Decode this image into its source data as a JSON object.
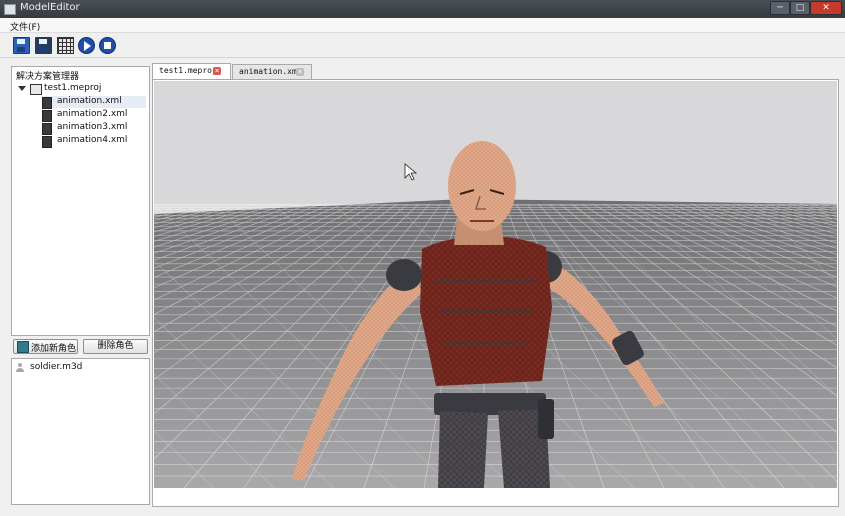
{
  "window": {
    "title": "ModelEditor",
    "controls": {
      "min": "─",
      "max": "□",
      "close": "✕"
    }
  },
  "menu": {
    "file": "文件(F)"
  },
  "toolbar": {
    "icons": [
      "save-icon",
      "save-all-icon",
      "grid-icon",
      "play-icon",
      "stop-icon"
    ]
  },
  "solution_explorer": {
    "title": "解决方案管理器",
    "project": "test1.meproj",
    "files": [
      "animation.xml",
      "animation2.xml",
      "animation3.xml",
      "animation4.xml"
    ],
    "selected_index": 0
  },
  "buttons": {
    "add_role": "添加新角色",
    "delete_role": "删除角色"
  },
  "roles": [
    "soldier.m3d"
  ],
  "tabs": [
    {
      "label": "test1.meproj",
      "active": true,
      "close": "×"
    },
    {
      "label": "animation.xml",
      "active": false,
      "close": "×"
    }
  ],
  "colors": {
    "sky": "#d8d8da",
    "ground": "#8a8a8c",
    "grid_line": "#ffffff",
    "skin": "#e0a888",
    "armor_red": "#7a2a20",
    "armor_dark": "#3a3b40"
  }
}
